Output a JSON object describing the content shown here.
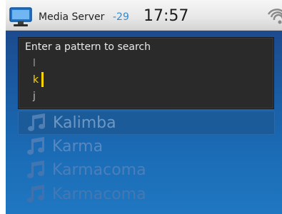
{
  "status_bar": {
    "app_icon": "computer-monitor-icon",
    "title": "Media Server",
    "signal_value": "-29",
    "time": "17:57",
    "wifi_icon": "wifi-icon"
  },
  "search": {
    "prompt": "Enter a pattern to search",
    "picker": {
      "previous_char": "l",
      "current_char": "k",
      "next_char": "j"
    }
  },
  "results": [
    {
      "icon": "music-note-icon",
      "label": "Kalimba",
      "selected": true
    },
    {
      "icon": "music-note-icon",
      "label": "Karma",
      "selected": false
    },
    {
      "icon": "music-note-icon",
      "label": "Karmacoma",
      "selected": false
    },
    {
      "icon": "music-note-icon",
      "label": "Karmacoma",
      "selected": false
    }
  ],
  "colors": {
    "accent_yellow": "#ffd400",
    "signal_blue": "#2f8bd6",
    "screen_blue": "#1b6db7"
  }
}
